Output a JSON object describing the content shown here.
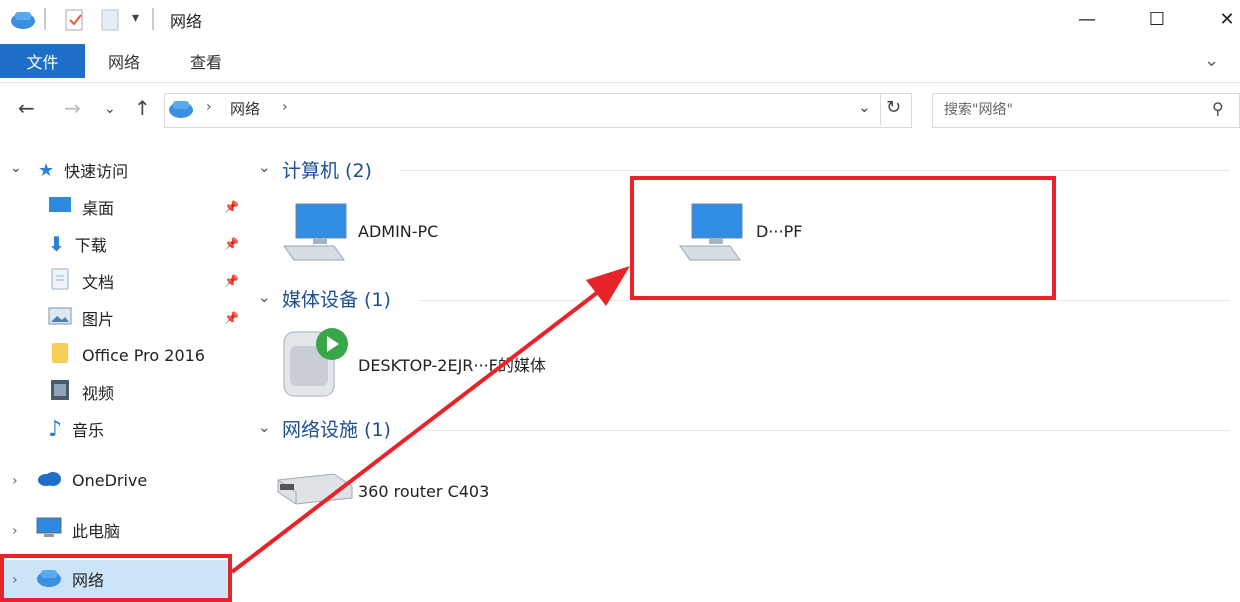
{
  "window": {
    "title": "网络",
    "controls": {
      "minimize": "—",
      "maximize": "☐",
      "close": "✕"
    }
  },
  "ribbon": {
    "tabs": [
      "文件",
      "网络",
      "查看"
    ],
    "help": "⌄"
  },
  "address": {
    "path": "网络",
    "search_placeholder": "搜索\"网络\""
  },
  "sidebar": {
    "quick_access": "快速访问",
    "items": [
      {
        "label": "桌面",
        "icon": "desktop-icon",
        "pinned": true
      },
      {
        "label": "下载",
        "icon": "download-icon",
        "pinned": true
      },
      {
        "label": "文档",
        "icon": "document-icon",
        "pinned": true
      },
      {
        "label": "图片",
        "icon": "picture-icon",
        "pinned": true
      },
      {
        "label": "Office Pro 2016",
        "icon": "folder-icon",
        "pinned": false
      },
      {
        "label": "视频",
        "icon": "video-icon",
        "pinned": false
      },
      {
        "label": "音乐",
        "icon": "music-icon",
        "pinned": false
      }
    ],
    "onedrive": "OneDrive",
    "this_pc": "此电脑",
    "network": "网络"
  },
  "groups": {
    "computers": {
      "header": "计算机 (2)",
      "items": [
        "ADMIN-PC",
        "D···PF"
      ]
    },
    "media": {
      "header": "媒体设备 (1)",
      "items": [
        "DESKTOP-2EJR···F的媒体"
      ]
    },
    "network_infra": {
      "header": "网络设施 (1)",
      "items": [
        "360 router C403"
      ]
    }
  },
  "colors": {
    "accent": "#1e6fc9",
    "highlight": "#e8242a",
    "selected": "#cce4f7"
  }
}
